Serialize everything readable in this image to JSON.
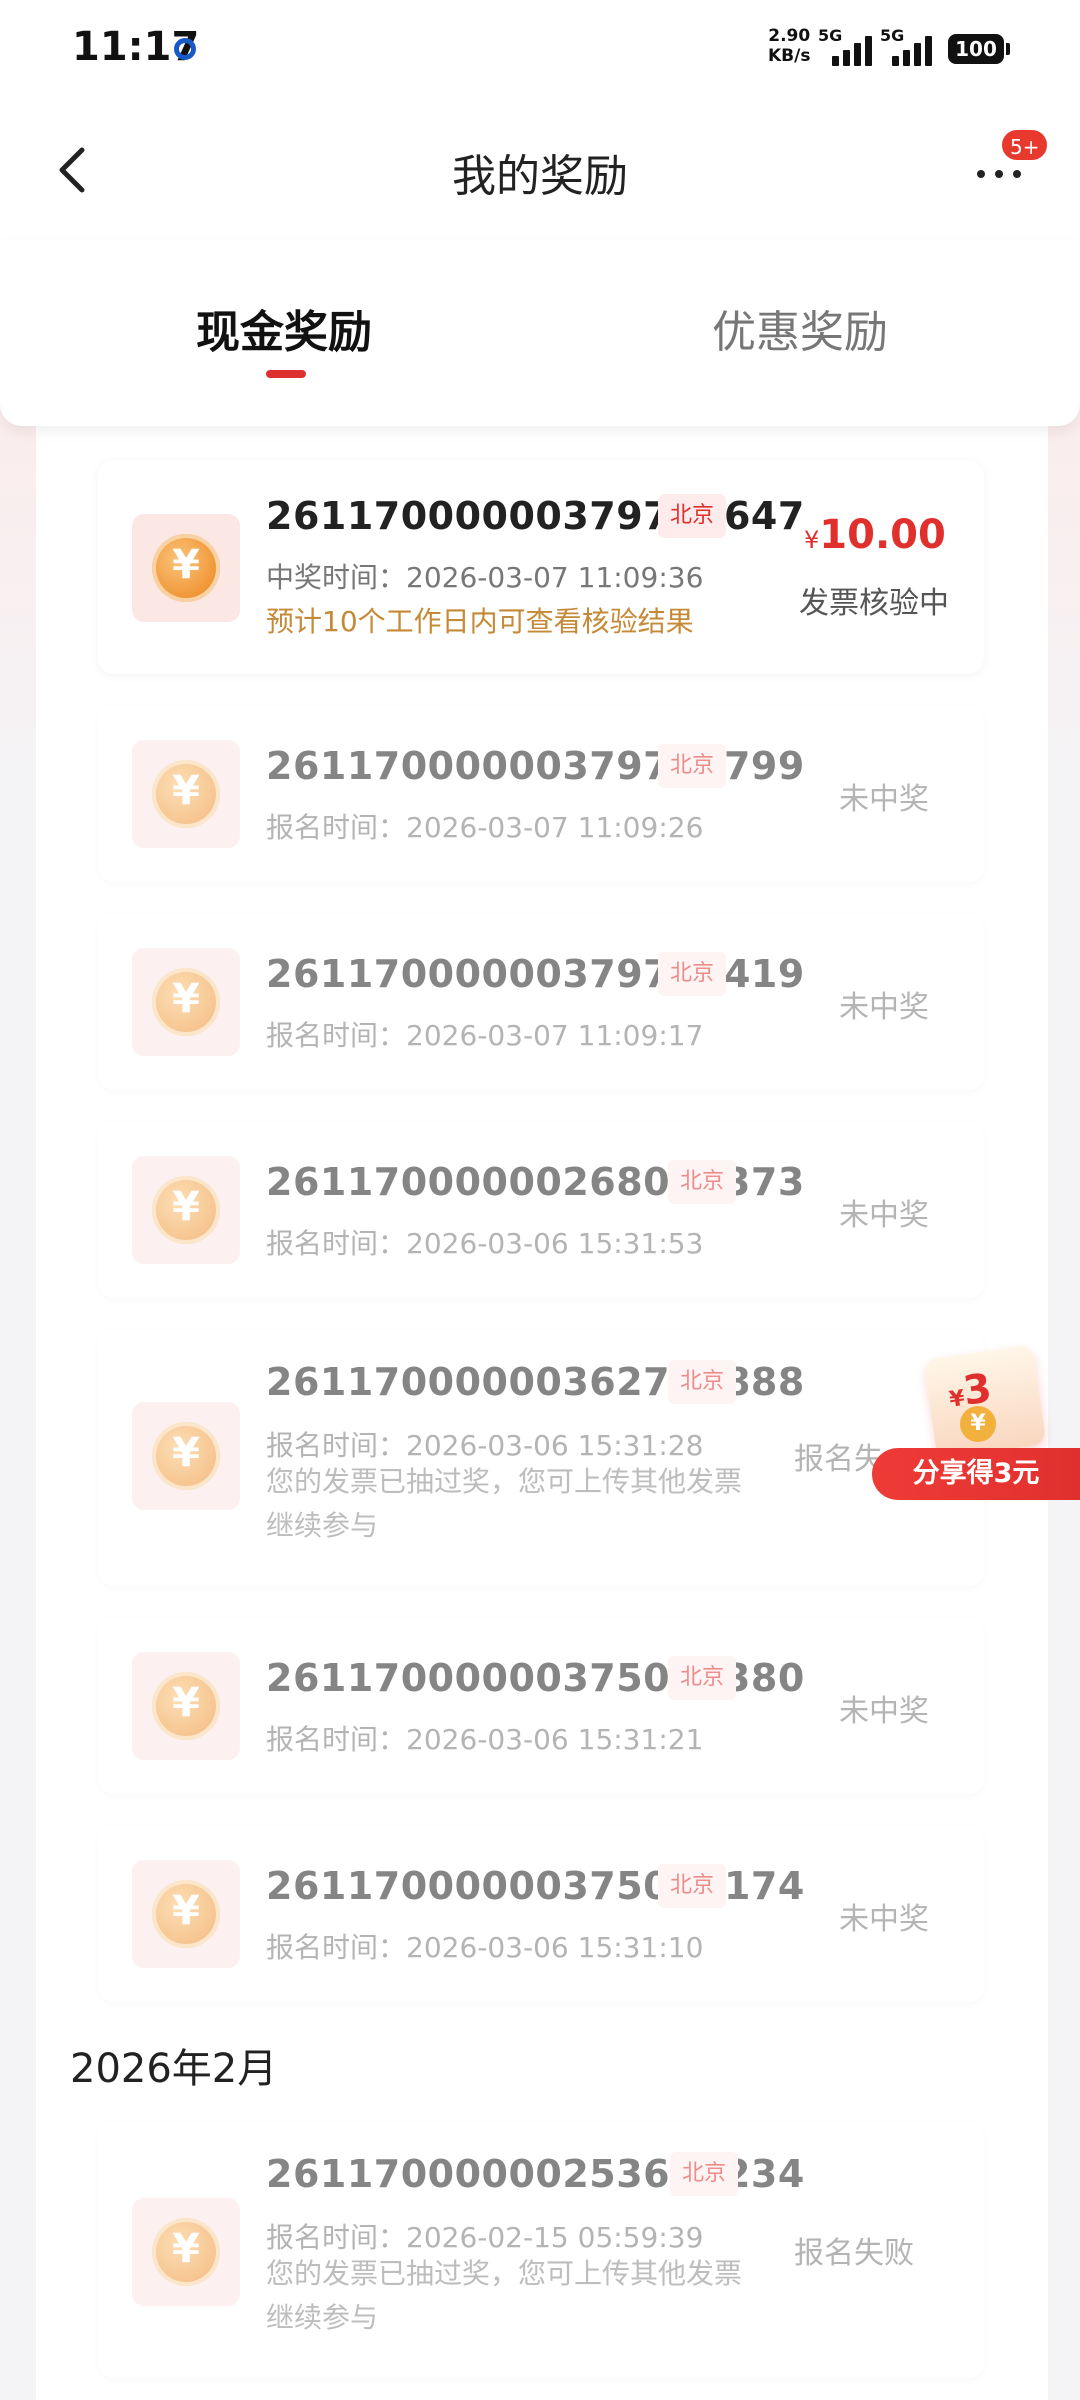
{
  "status_bar": {
    "time": "11:17",
    "speed_value": "2.90",
    "speed_unit": "KB/s",
    "network_1": "5G",
    "network_2": "5G",
    "battery": "100"
  },
  "header": {
    "title": "我的奖励",
    "badge": "5+"
  },
  "tabs": [
    {
      "label": "现金奖励",
      "active": true
    },
    {
      "label": "优惠奖励",
      "active": false
    }
  ],
  "records": [
    {
      "id": "26117000000379717647",
      "city": "北京",
      "time_label": "中奖时间：2026-03-07 11:09:36",
      "note": "预计10个工作日内可查看核验结果",
      "currency": "¥",
      "amount": "10.00",
      "status": "发票核验中"
    },
    {
      "id": "26117000000379721799",
      "city": "北京",
      "time_label": "报名时间：2026-03-07 11:09:26",
      "status": "未中奖"
    },
    {
      "id": "26117000000379717419",
      "city": "北京",
      "time_label": "报名时间：2026-03-07 11:09:17",
      "status": "未中奖"
    },
    {
      "id": "26117000000268003373",
      "city": "北京",
      "time_label": "报名时间：2026-03-06 15:31:53",
      "status": "未中奖"
    },
    {
      "id": "26117000000362732888",
      "city": "北京",
      "time_label": "报名时间：2026-03-06 15:31:28",
      "note_line1": "您的发票已抽过奖，您可上传其他发票",
      "note_line2": "继续参与",
      "status": "报名失"
    },
    {
      "id": "26117000000375072380",
      "city": "北京",
      "time_label": "报名时间：2026-03-06 15:31:21",
      "status": "未中奖"
    },
    {
      "id": "26117000000375071174",
      "city": "北京",
      "time_label": "报名时间：2026-03-06 15:31:10",
      "status": "未中奖"
    },
    {
      "id": "26117000000253659234",
      "city": "北京",
      "time_label": "报名时间：2026-02-15 05:59:39",
      "note_line1": "您的发票已抽过奖，您可上传其他发票",
      "note_line2": "继续参与",
      "status": "报名失败"
    }
  ],
  "month_label": "2026年2月",
  "share": {
    "currency": "¥",
    "amount": "3",
    "button_label": "分享得3元"
  },
  "colors": {
    "accent": "#e0302e",
    "note": "#c58a37"
  },
  "icons": {
    "back": "chevron-left-icon",
    "more": "more-dots-icon",
    "coin": "yuan-coin-icon"
  }
}
